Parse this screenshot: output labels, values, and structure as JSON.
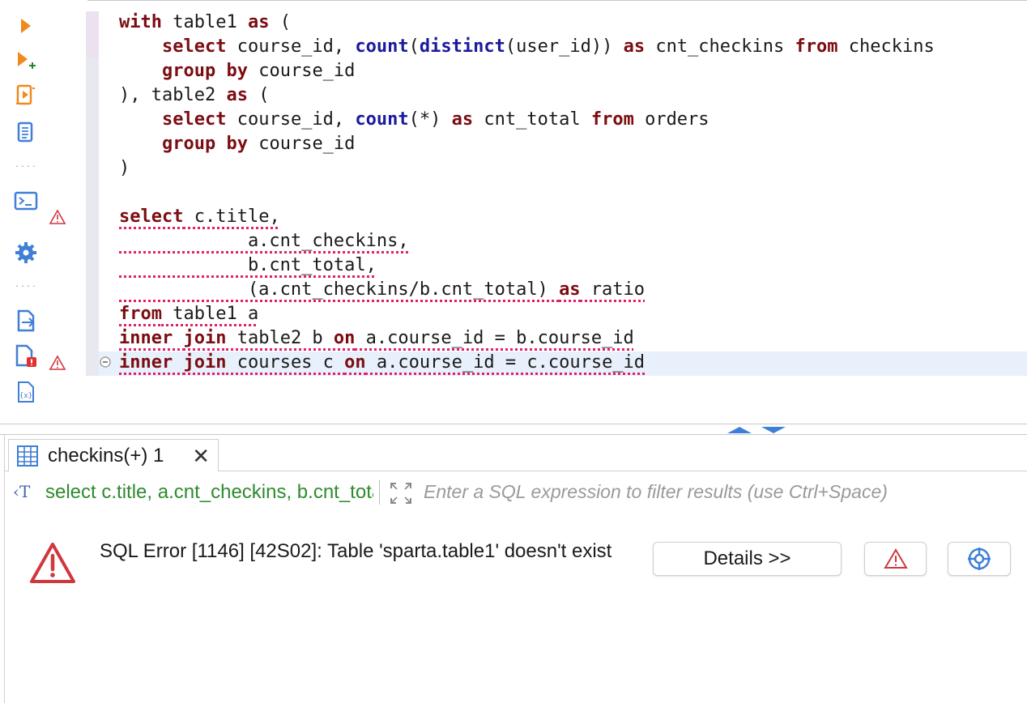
{
  "editor": {
    "lines": [
      "with table1 as (",
      "    select course_id, count(distinct(user_id)) as cnt_checkins from checkins",
      "    group by course_id",
      "), table2 as (",
      "    select course_id, count(*) as cnt_total from orders",
      "    group by course_id",
      ")",
      "",
      "select c.title,",
      "            a.cnt_checkins,",
      "            b.cnt_total,",
      "            (a.cnt_checkins/b.cnt_total) as ratio",
      "from table1 a",
      "inner join table2 b on a.course_id = b.course_id",
      "inner join courses c on a.course_id = c.course_id"
    ],
    "error_lines": [
      9,
      10,
      11,
      12,
      13,
      14,
      15
    ],
    "current_line": 15,
    "keywords": [
      "with",
      "as",
      "select",
      "from",
      "group",
      "by",
      "inner",
      "join",
      "on"
    ],
    "functions": [
      "count",
      "distinct"
    ],
    "colors": {
      "keyword": "#7b0d12",
      "function": "#1b1a9c",
      "error_underline": "#e0206a",
      "current_line": "#e8f0fb"
    }
  },
  "toolbar": {
    "icons": [
      "execute-statement-icon",
      "execute-new-tab-icon",
      "execute-script-icon",
      "execute-script-new-tab-icon",
      "console-icon",
      "settings-gear-icon",
      "export-icon",
      "problems-icon",
      "variables-icon"
    ]
  },
  "results": {
    "tab_label": "checkins(+) 1",
    "query_preview": "select c.title, a.cnt_checkins, b.cnt_total, (a.cnt_checkins/b.cnt_total) as ratio from table1 a inner join table2 b on a.course_id = b.course_id inner join courses c on a.course_id = c.course_id",
    "filter_placeholder": "Enter a SQL expression to filter results (use Ctrl+Space)",
    "error_message": "SQL Error [1146] [42S02]: Table 'sparta.table1' doesn't exist",
    "details_button": "Details >>",
    "colors": {
      "error_red": "#d0373f",
      "query_green": "#2f8a2f",
      "link_blue": "#3f7fd6"
    }
  }
}
